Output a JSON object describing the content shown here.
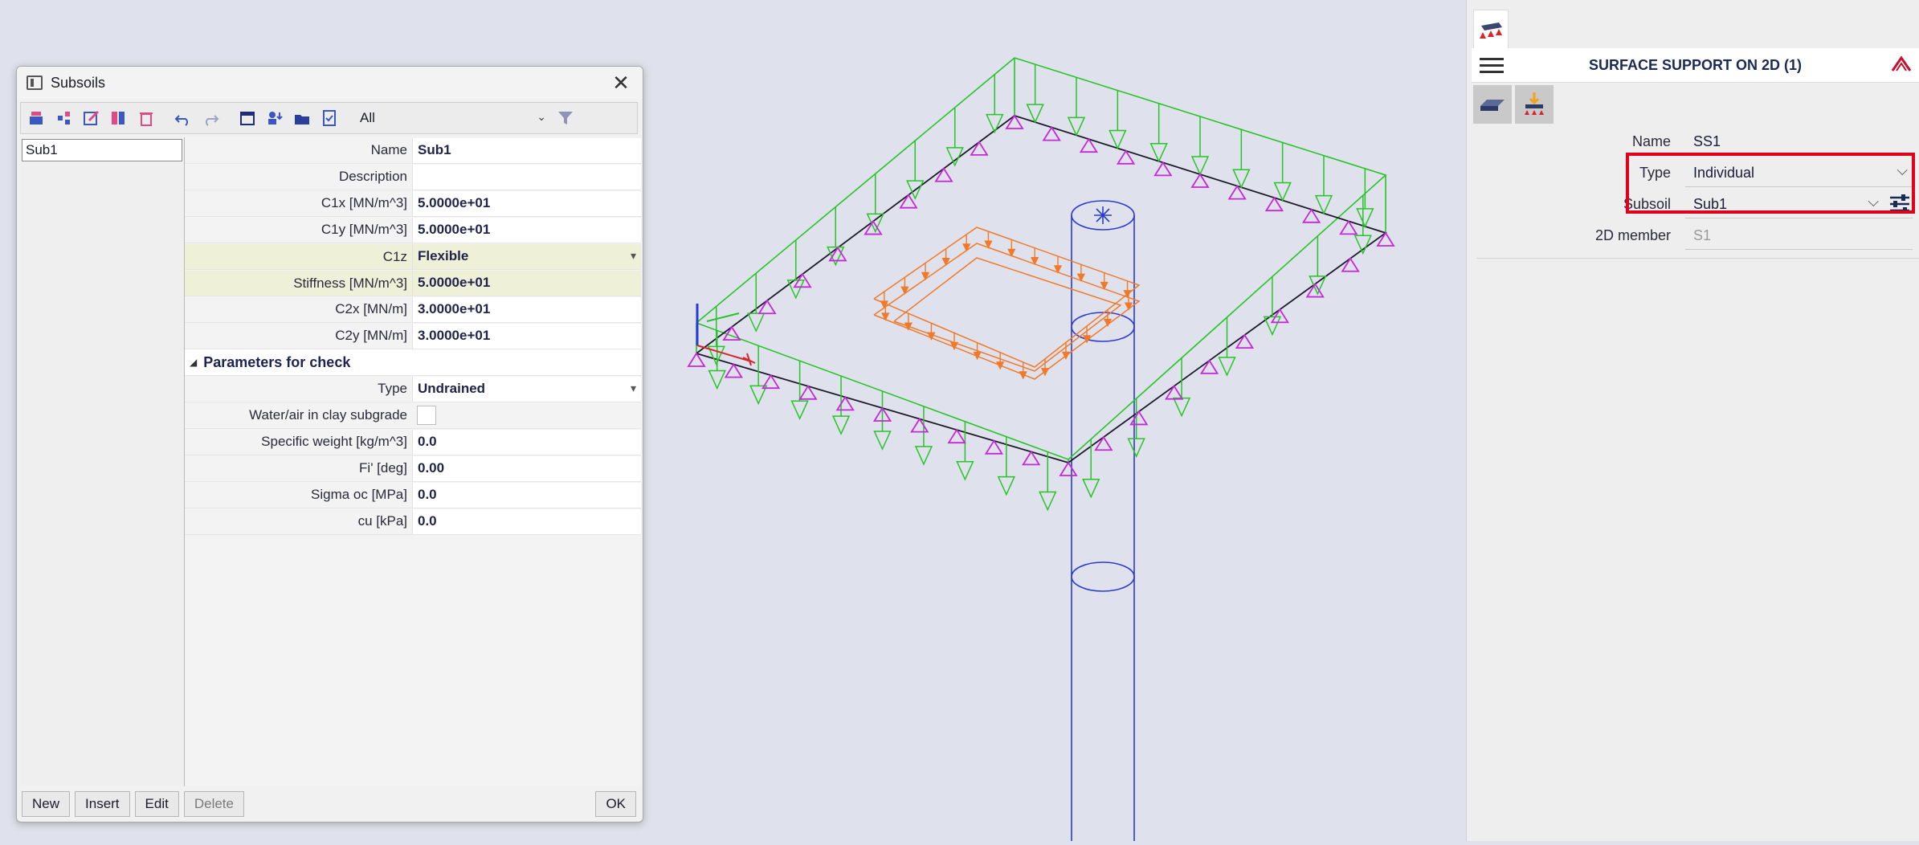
{
  "dialog": {
    "title": "Subsoils",
    "filter": {
      "selected": "All"
    },
    "list": [
      "Sub1"
    ],
    "props": [
      {
        "label": "Name",
        "value": "Sub1"
      },
      {
        "label": "Description",
        "value": ""
      },
      {
        "label": "C1x [MN/m^3]",
        "value": "5.0000e+01"
      },
      {
        "label": "C1y [MN/m^3]",
        "value": "5.0000e+01"
      },
      {
        "label": "C1z",
        "value": "Flexible"
      },
      {
        "label": "Stiffness [MN/m^3]",
        "value": "5.0000e+01"
      },
      {
        "label": "C2x [MN/m]",
        "value": "3.0000e+01"
      },
      {
        "label": "C2y [MN/m]",
        "value": "3.0000e+01"
      }
    ],
    "section": "Parameters for check",
    "check_props": [
      {
        "label": "Type",
        "value": "Undrained"
      },
      {
        "label": "Water/air in clay subgrade",
        "value": ""
      },
      {
        "label": "Specific weight [kg/m^3]",
        "value": "0.0"
      },
      {
        "label": "Fi' [deg]",
        "value": "0.00"
      },
      {
        "label": "Sigma oc [MPa]",
        "value": "0.0"
      },
      {
        "label": "cu [kPa]",
        "value": "0.0"
      }
    ],
    "buttons": {
      "new": "New",
      "insert": "Insert",
      "edit": "Edit",
      "delete": "Delete",
      "ok": "OK"
    }
  },
  "panel": {
    "title": "SURFACE SUPPORT ON 2D (1)",
    "rows": [
      {
        "label": "Name",
        "value": "SS1"
      },
      {
        "label": "Type",
        "value": "Individual"
      },
      {
        "label": "Subsoil",
        "value": "Sub1"
      },
      {
        "label": "2D member",
        "value": "S1"
      }
    ]
  },
  "colors": {
    "support": "#27c427",
    "hinge": "#c428d8",
    "load": "#f07a2a",
    "column": "#2a3ad0",
    "highlight": "#e1001a"
  }
}
